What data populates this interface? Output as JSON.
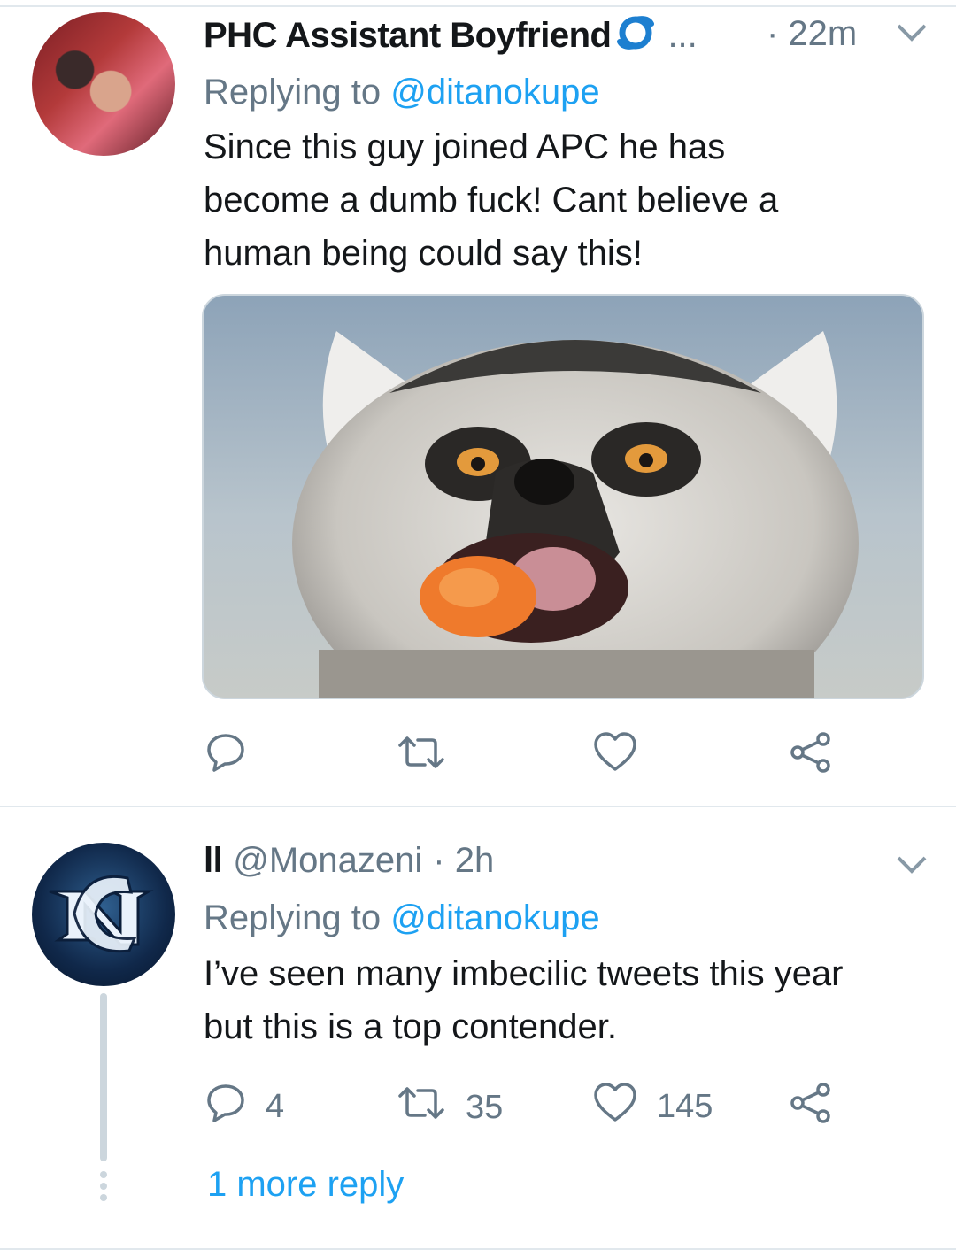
{
  "tweet1": {
    "name": "PHC Assistant Boyfriend",
    "name_suffix": "...",
    "time": "· 22m",
    "replying_prefix": "Replying to ",
    "replying_handle": "@ditanokupe",
    "text_line1": "Since this guy joined APC he has",
    "text_line2": "become a dumb fuck! Cant believe a",
    "text_line3": "human being could say this!",
    "icons": [
      "reply-icon",
      "retweet-icon",
      "like-icon",
      "share-icon"
    ]
  },
  "tweet2": {
    "name": "ll",
    "handle": "@Monazeni",
    "time": "· 2h",
    "replying_prefix": "Replying to ",
    "replying_handle": "@ditanokupe",
    "text_line1": "I’ve seen many imbecilic tweets this year",
    "text_line2": "but this is a top contender.",
    "reply_count": "4",
    "retweet_count": "35",
    "like_count": "145",
    "more_replies": "1 more reply"
  },
  "colors": {
    "link": "#1da1f2",
    "secondary": "#657786",
    "text": "#14171a",
    "divider": "#e1e8ed"
  }
}
